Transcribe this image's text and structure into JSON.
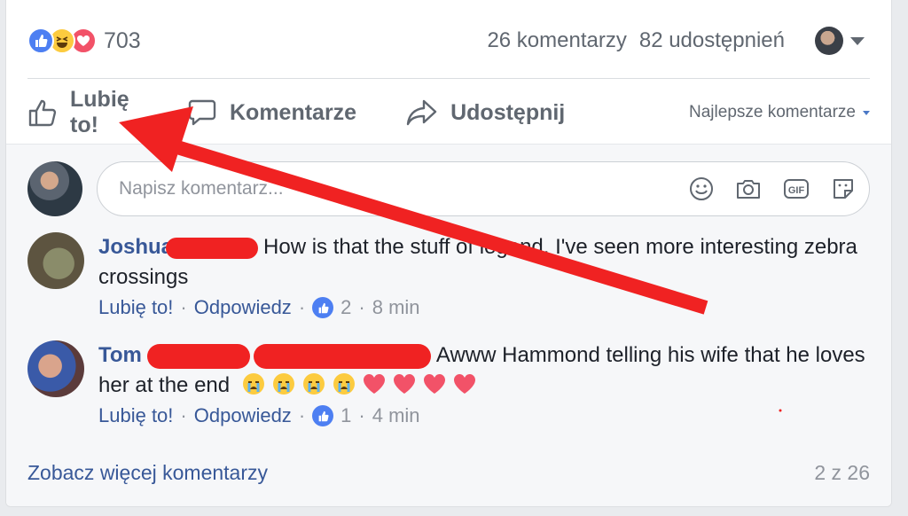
{
  "reactions": {
    "count": "703",
    "icons": [
      "like-icon",
      "haha-icon",
      "love-icon"
    ]
  },
  "stats": {
    "comments": "26 komentarzy",
    "shares": "82 udostępnień"
  },
  "actions": {
    "like_label": "Lubię to!",
    "comment_label": "Komentarze",
    "share_label": "Udostępnij",
    "sort_label": "Najlepsze komentarze"
  },
  "composer": {
    "placeholder": "Napisz komentarz...",
    "icons": [
      "smiley-icon",
      "camera-icon",
      "gif-icon",
      "sticker-icon"
    ]
  },
  "comments": [
    {
      "author": "Joshua",
      "text": "How is that the stuff of legend, I've seen more interesting zebra crossings",
      "like_label": "Lubię to!",
      "reply_label": "Odpowiedz",
      "likes": "2",
      "time": "8 min"
    },
    {
      "author": "Tom",
      "text": "Awww Hammond telling his wife that he loves her at the end",
      "emojis": [
        "😭",
        "😭",
        "😭",
        "😭",
        "❤",
        "❤",
        "❤",
        "❤"
      ],
      "like_label": "Lubię to!",
      "reply_label": "Odpowiedz",
      "likes": "1",
      "time": "4 min"
    }
  ],
  "footer": {
    "more_label": "Zobacz więcej komentarzy",
    "pagination": "2 z 26"
  },
  "colors": {
    "link": "#385898",
    "annotation_arrow": "#f02222",
    "like_blue": "#4d7ff2"
  }
}
